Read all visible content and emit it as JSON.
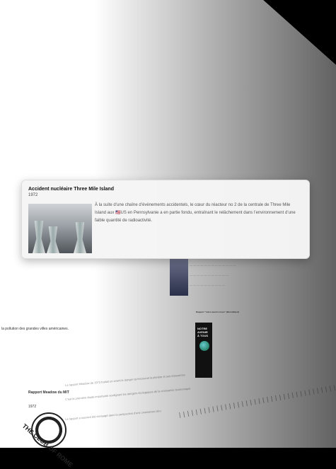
{
  "popup": {
    "title": "Accident nucléaire Three Mile Island",
    "year": "1972",
    "description": "À la suite d’une chaîne d’évènements accidentels, le cœur du réacteur no 2 de la centrale de Three Mile Island aux 🇺🇸US en Pennsylvanie a en partie fondu, entraînant le relâchement dans l’environnement d’une faible quantité de radioactivité."
  },
  "background_texts": {
    "pollution": "la pollution des grandes villes américaines.",
    "rapport_title": "Rapport Meadow du MIT",
    "rapport_year": "1972",
    "rapport_p1": "Le rapport Meadow de 1972 traitait un avant le danger qu'encourait la planète et ses ressources",
    "rapport_p2": "C'est la première étude importante soulignant les dangers écologiques de la croissance économique",
    "rapport_p3": "Le rapport a souvent été envisagé dans la perspective d'une croissance zéro",
    "section_title": "Rapport \"notre avenir à tous\" (Brundtland)",
    "poster_text": "NOTRE AVENIR À TOUS",
    "logo_text": "THE CLUB OF ROME"
  }
}
